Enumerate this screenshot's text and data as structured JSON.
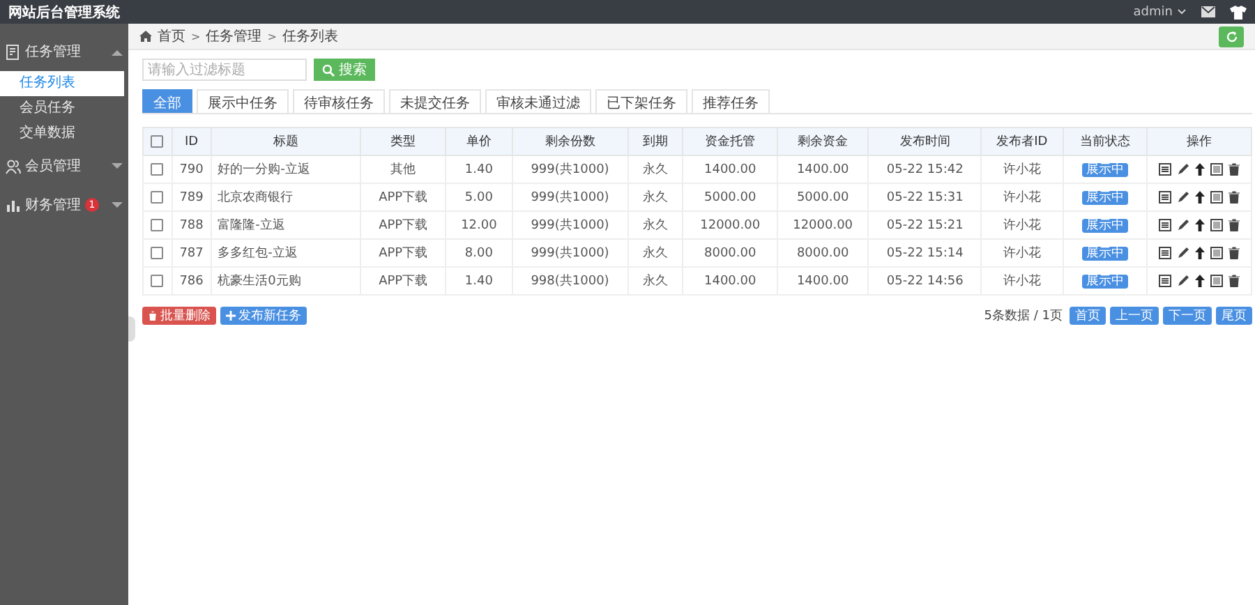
{
  "app_title": "网站后台管理系统",
  "user": {
    "name": "admin"
  },
  "sidebar": {
    "groups": [
      {
        "label": "任务管理",
        "kind": "task",
        "expanded": true,
        "children": [
          {
            "label": "任务列表",
            "selected": true
          },
          {
            "label": "会员任务",
            "selected": false
          },
          {
            "label": "交单数据",
            "selected": false
          }
        ]
      },
      {
        "label": "会员管理",
        "kind": "users",
        "expanded": false
      },
      {
        "label": "财务管理",
        "kind": "finance",
        "expanded": false,
        "badge": "1"
      }
    ]
  },
  "breadcrumb": {
    "separator": ">",
    "items": [
      "首页",
      "任务管理",
      "任务列表"
    ]
  },
  "search": {
    "placeholder": "请输入过滤标题",
    "button": "搜索"
  },
  "tabs": [
    {
      "label": "全部",
      "selected": true
    },
    {
      "label": "展示中任务",
      "selected": false
    },
    {
      "label": "待审核任务",
      "selected": false
    },
    {
      "label": "未提交任务",
      "selected": false
    },
    {
      "label": "审核未通过滤",
      "selected": false
    },
    {
      "label": "已下架任务",
      "selected": false
    },
    {
      "label": "推荐任务",
      "selected": false
    }
  ],
  "table": {
    "select_all_checked": false,
    "columns": [
      "ID",
      "标题",
      "类型",
      "单价",
      "剩余份数",
      "到期",
      "资金托管",
      "剩余资金",
      "发布时间",
      "发布者ID",
      "当前状态",
      "操作"
    ],
    "rows": [
      {
        "checked": false,
        "cells": [
          "790",
          "好的一分购-立返",
          "其他",
          "1.40",
          "999(共1000)",
          "永久",
          "1400.00",
          "1400.00",
          "05-22 15:42",
          "许小花"
        ],
        "status": "展示中"
      },
      {
        "checked": false,
        "cells": [
          "789",
          "北京农商银行",
          "APP下载",
          "5.00",
          "999(共1000)",
          "永久",
          "5000.00",
          "5000.00",
          "05-22 15:31",
          "许小花"
        ],
        "status": "展示中"
      },
      {
        "checked": false,
        "cells": [
          "788",
          "富隆隆-立返",
          "APP下载",
          "12.00",
          "999(共1000)",
          "永久",
          "12000.00",
          "12000.00",
          "05-22 15:21",
          "许小花"
        ],
        "status": "展示中"
      },
      {
        "checked": false,
        "cells": [
          "787",
          "多多红包-立返",
          "APP下载",
          "8.00",
          "999(共1000)",
          "永久",
          "8000.00",
          "8000.00",
          "05-22 15:14",
          "许小花"
        ],
        "status": "展示中"
      },
      {
        "checked": false,
        "cells": [
          "786",
          "杭豪生活0元购",
          "APP下载",
          "1.40",
          "998(共1000)",
          "永久",
          "1400.00",
          "1400.00",
          "05-22 14:56",
          "许小花"
        ],
        "status": "展示中"
      }
    ]
  },
  "actions": [
    {
      "label": "批量删除",
      "kind": "danger"
    },
    {
      "label": "发布新任务",
      "kind": "primary"
    }
  ],
  "pagination": {
    "summary": "5条数据 / 1页",
    "buttons": [
      "首页",
      "上一页",
      "下一页",
      "尾页"
    ]
  }
}
